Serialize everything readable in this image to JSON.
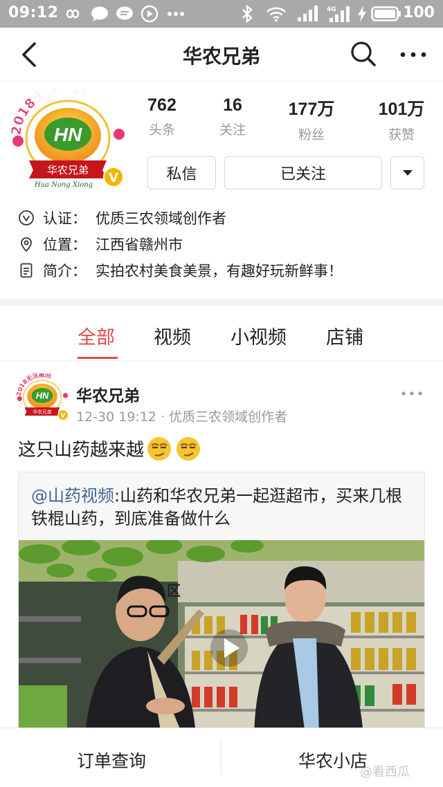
{
  "status_bar": {
    "time": "09:12",
    "battery": "100",
    "icons": [
      "infinity-icon",
      "chat-bubble-icon",
      "message-icon",
      "play-circle-icon",
      "ellipsis-icon",
      "bluetooth-icon",
      "wifi-icon",
      "signal-icon",
      "4g-signal-icon",
      "charging-icon",
      "battery-icon"
    ]
  },
  "nav": {
    "title": "华农兄弟",
    "icons": [
      "back-arrow-icon",
      "search-icon",
      "more-icon"
    ]
  },
  "profile": {
    "avatar_logo_text": "HN",
    "avatar_banner_text": "2018无法撤回",
    "avatar_ribbon_text": "华农兄弟",
    "avatar_pinyin_text": "Hua Nong Xiong",
    "stats": [
      {
        "value": "762",
        "label": "头条"
      },
      {
        "value": "16",
        "label": "关注"
      },
      {
        "value": "177万",
        "label": "粉丝"
      },
      {
        "value": "101万",
        "label": "获赞"
      }
    ],
    "buttons": {
      "message": "私信",
      "following": "已关注"
    },
    "info": [
      {
        "icon": "verified-icon",
        "key": "认证：",
        "value": "优质三农领域创作者"
      },
      {
        "icon": "location-pin-icon",
        "key": "位置：",
        "value": "江西省赣州市"
      },
      {
        "icon": "document-icon",
        "key": "简介：",
        "value": "实拍农村美食美景，有趣好玩新鲜事！"
      }
    ]
  },
  "tabs": [
    {
      "label": "全部",
      "active": true
    },
    {
      "label": "视频",
      "active": false
    },
    {
      "label": "小视频",
      "active": false
    },
    {
      "label": "店铺",
      "active": false
    }
  ],
  "post": {
    "author": "华农兄弟",
    "time": "12-30 19:12",
    "separator": "·",
    "author_tag": "优质三农领域创作者",
    "text": "这只山药越来越",
    "quote_mention": "@山药视频",
    "quote_body": ":山药和华农兄弟一起逛超市，买来几根铁棍山药，到底准备做什么",
    "video_sign_text": "区"
  },
  "bottom_bar": {
    "left": "订单查询",
    "right": "华农小店"
  },
  "watermark": "@看西瓜",
  "colors": {
    "accent": "#e24a4a",
    "mention": "#406599",
    "status_bar": "#a9a9a9"
  }
}
